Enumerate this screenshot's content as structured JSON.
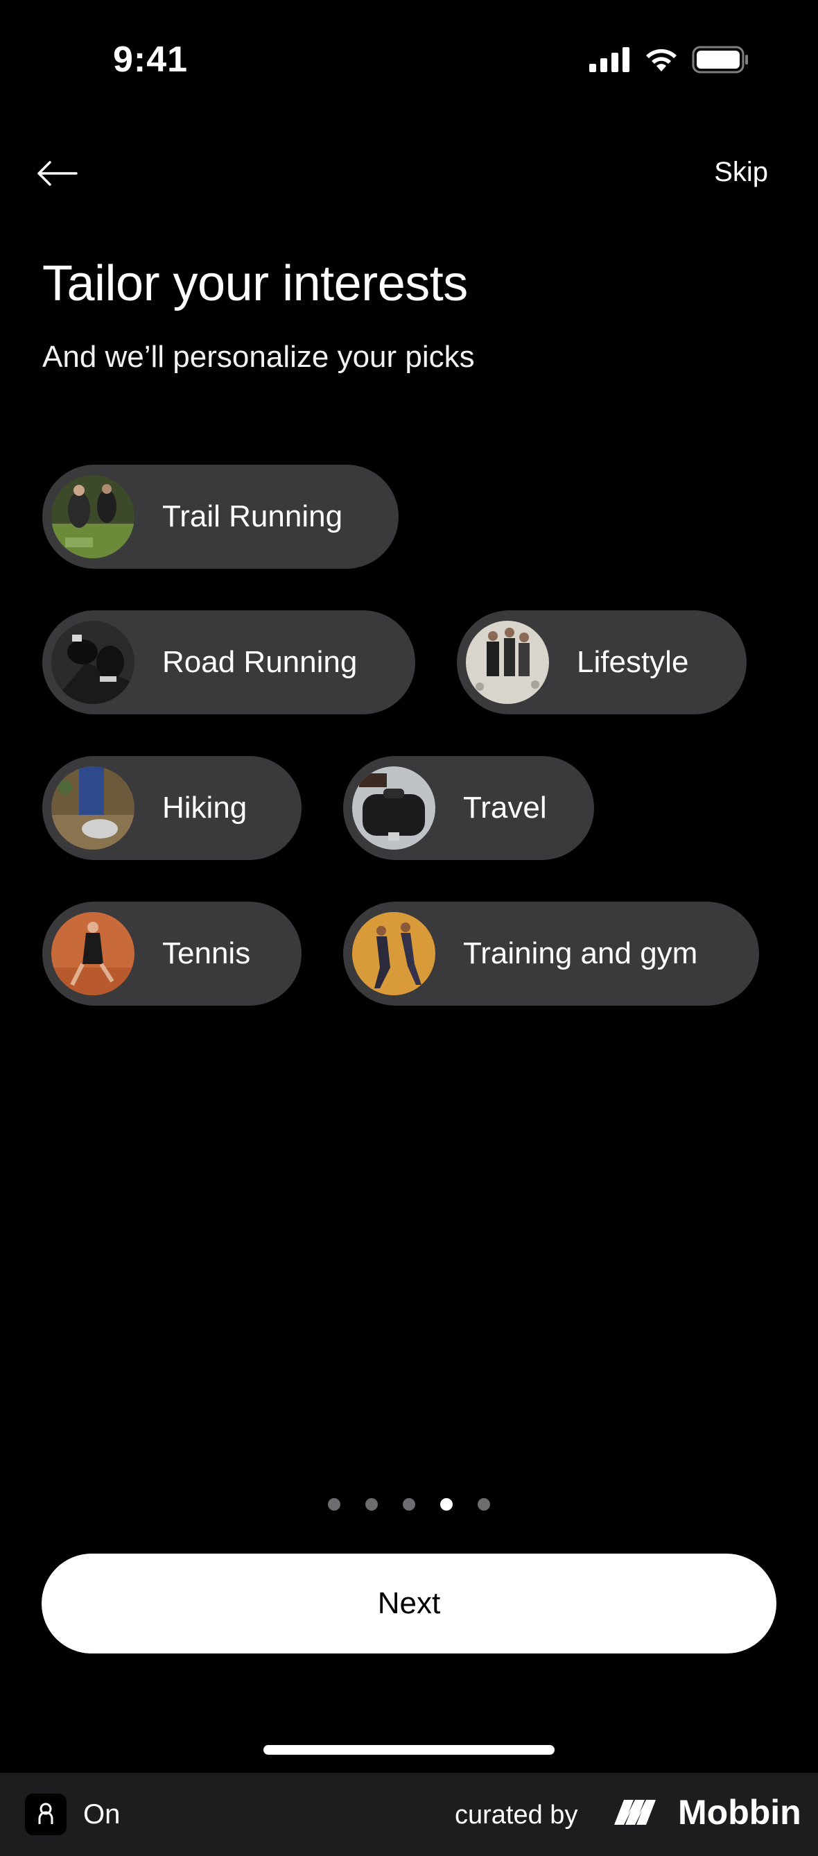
{
  "status_bar": {
    "time": "9:41"
  },
  "nav": {
    "skip_label": "Skip"
  },
  "header": {
    "title": "Tailor your interests",
    "subtitle": "And we’ll personalize your picks"
  },
  "interests": [
    {
      "label": "Trail Running",
      "thumb_icon": "trail-running-photo"
    },
    {
      "label": "Road Running",
      "thumb_icon": "road-running-photo"
    },
    {
      "label": "Lifestyle",
      "thumb_icon": "lifestyle-photo"
    },
    {
      "label": "Hiking",
      "thumb_icon": "hiking-photo"
    },
    {
      "label": "Travel",
      "thumb_icon": "travel-photo"
    },
    {
      "label": "Tennis",
      "thumb_icon": "tennis-photo"
    },
    {
      "label": "Training and gym",
      "thumb_icon": "training-photo"
    }
  ],
  "pagination": {
    "total": 5,
    "current": 4
  },
  "next_label": "Next",
  "footer": {
    "app_name": "On",
    "curated_by": "curated by",
    "brand": "Mobbin"
  },
  "colors": {
    "background": "#000000",
    "chip": "#3a393c",
    "button": "#ffffff",
    "dot_inactive": "#6d6d70"
  }
}
